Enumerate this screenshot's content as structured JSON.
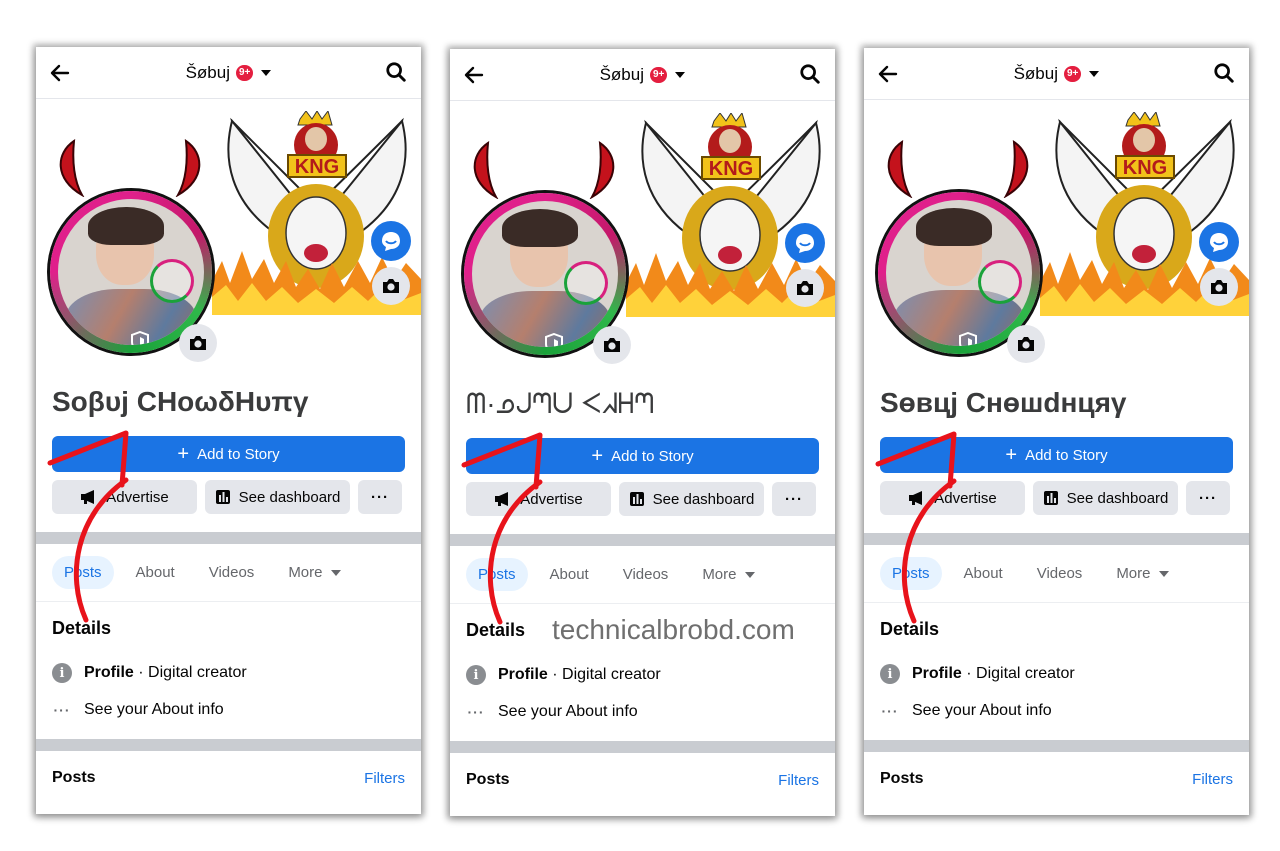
{
  "colors": {
    "accent": "#1b74e4",
    "badge": "#e41e3f",
    "annotation_arrow": "#e8131b"
  },
  "watermark": "technicalbrobd.com",
  "phones": [
    {
      "topbar": {
        "handle": "Šøbuj",
        "badge": "9+"
      },
      "profile_name": "Soβυj CHoωδHυπγ",
      "buttons": {
        "add_story": "Add to Story",
        "advertise": "Advertise",
        "dashboard": "See dashboard",
        "more": "···"
      },
      "tabs": [
        "Posts",
        "About",
        "Videos",
        "More"
      ],
      "details": {
        "title": "Details",
        "profile_label": "Profile",
        "profile_value": "· Digital creator",
        "about_link": "See your About info"
      },
      "posts": {
        "title": "Posts",
        "filters": "Filters"
      }
    },
    {
      "topbar": {
        "handle": "Šøbuj",
        "badge": "9+"
      },
      "profile_name": "ᗰ·ᓄᒍᘉᑌ ᐸᖽᕼᘉ",
      "buttons": {
        "add_story": "Add to Story",
        "advertise": "Advertise",
        "dashboard": "See dashboard",
        "more": "···"
      },
      "tabs": [
        "Posts",
        "About",
        "Videos",
        "More"
      ],
      "details": {
        "title": "Details",
        "profile_label": "Profile",
        "profile_value": "· Digital creator",
        "about_link": "See your About info"
      },
      "posts": {
        "title": "Posts",
        "filters": "Filters"
      }
    },
    {
      "topbar": {
        "handle": "Šøbuj",
        "badge": "9+"
      },
      "profile_name": "Sөвцj Снөшdнцяγ",
      "buttons": {
        "add_story": "Add to Story",
        "advertise": "Advertise",
        "dashboard": "See dashboard",
        "more": "···"
      },
      "tabs": [
        "Posts",
        "About",
        "Videos",
        "More"
      ],
      "details": {
        "title": "Details",
        "profile_label": "Profile",
        "profile_value": "· Digital creator",
        "about_link": "See your About info"
      },
      "posts": {
        "title": "Posts",
        "filters": "Filters"
      }
    }
  ]
}
